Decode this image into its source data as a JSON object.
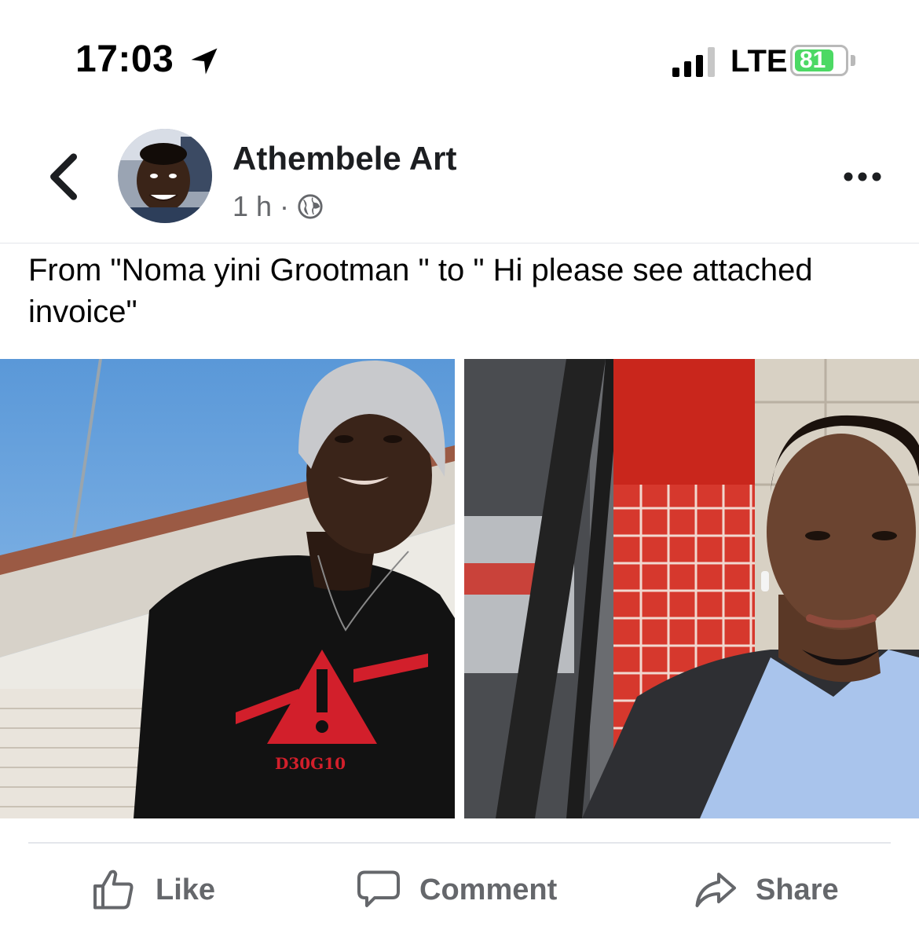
{
  "status_bar": {
    "time": "17:03",
    "network": "LTE",
    "battery_percent": "81",
    "battery_level": 0.81,
    "charging": true,
    "signal_bars_active": 3,
    "location_icon": "location-arrow-icon"
  },
  "post": {
    "author": "Athembele Art",
    "time_ago": "1 h",
    "separator": "·",
    "audience_icon": "globe-icon",
    "text": "From \"Noma yini Grootman \" to \" Hi please see attached invoice\"",
    "shirt_text": "D30G10"
  },
  "actions": {
    "like_label": "Like",
    "comment_label": "Comment",
    "share_label": "Share"
  },
  "colors": {
    "text_primary": "#050505",
    "text_secondary": "#65676b",
    "battery_green": "#4cd964",
    "divider": "#e4e6eb"
  }
}
